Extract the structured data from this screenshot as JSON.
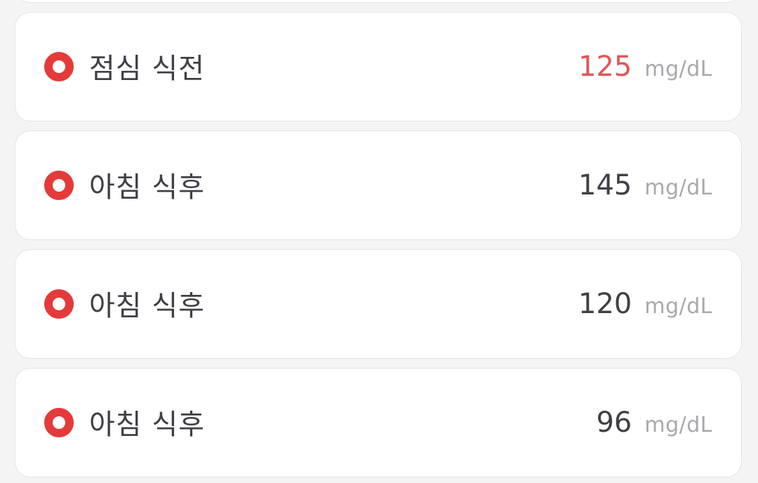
{
  "readings": [
    {
      "label": "점심 식전",
      "value": "125",
      "unit": "mg/dL",
      "value_color": "#e25555",
      "status": "high"
    },
    {
      "label": "아침 식후",
      "value": "145",
      "unit": "mg/dL",
      "value_color": "#3f3f46",
      "status": "normal"
    },
    {
      "label": "아침 식후",
      "value": "120",
      "unit": "mg/dL",
      "value_color": "#3f3f46",
      "status": "normal"
    },
    {
      "label": "아침 식후",
      "value": "96",
      "unit": "mg/dL",
      "value_color": "#3f3f46",
      "status": "normal"
    }
  ],
  "colors": {
    "indicator": "#e53a3a",
    "background": "#f4f4f5",
    "card": "#ffffff",
    "unit_text": "#a8a8ad"
  },
  "icons": {
    "indicator": "ring-dot-icon"
  }
}
